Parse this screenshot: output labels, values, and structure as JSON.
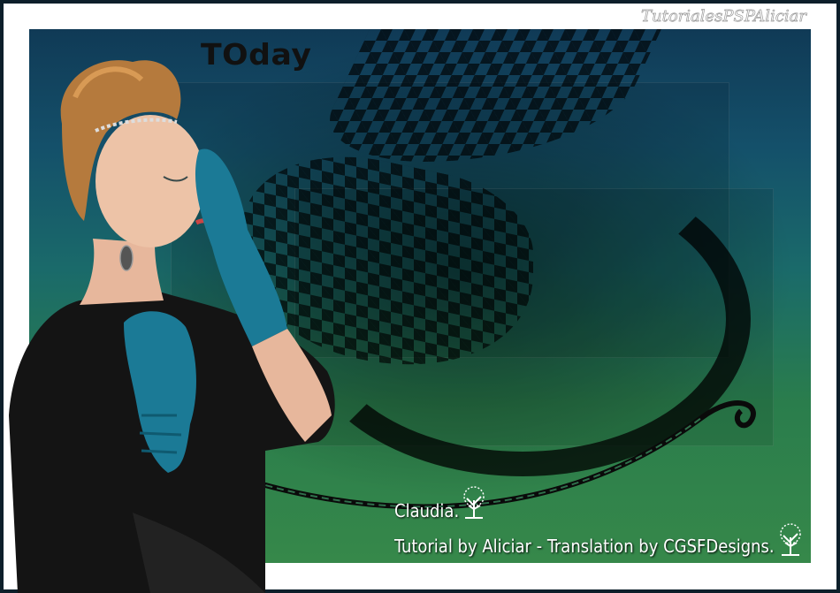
{
  "image": {
    "title_text": "TOday",
    "watermark_text": "TutorialesPSPAliciar",
    "credits": {
      "line1": "Claudia.",
      "line2": "Tutorial by Aliciar - Translation by CGSFDesigns."
    },
    "colors": {
      "frame_outer": "#0d1f2a",
      "frame_inner": "#ffffff",
      "background_top": "#103a56",
      "background_bottom": "#36884a",
      "glove": "#1b7a96",
      "dress": "#141414"
    }
  }
}
